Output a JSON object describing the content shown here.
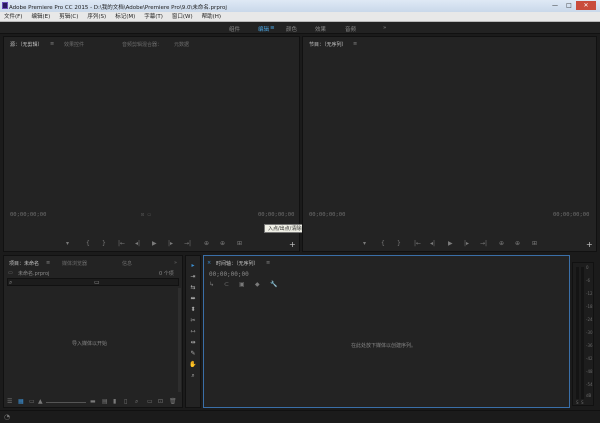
{
  "window": {
    "title": "Adobe Premiere Pro CC 2015 - D:\\我的文档\\Adobe\\Premiere Pro\\9.0\\未命名.prproj",
    "minimize": "—",
    "maximize": "□",
    "close": "✕"
  },
  "menu": [
    "文件(F)",
    "编辑(E)",
    "剪辑(C)",
    "序列(S)",
    "标记(M)",
    "字幕(T)",
    "窗口(W)",
    "帮助(H)"
  ],
  "workspaces": {
    "tabs": [
      "组件",
      "编辑",
      "颜色",
      "效果",
      "音频"
    ],
    "active": "编辑",
    "edit_menu_glyph": "≡",
    "more": "»"
  },
  "source_monitor": {
    "tabs": [
      "源：（无剪辑）",
      "效果控件",
      "音频剪辑混合器：",
      "元数据"
    ],
    "menu_glyph": "≡",
    "timecode_left": "00;00;00;00",
    "timecode_right": "00;00;00;00",
    "add_glyph": "+",
    "controls": [
      "▾",
      "{",
      "}",
      "|←",
      "◂|",
      "▶",
      "|▸",
      "→|",
      "⊕",
      "⊕",
      "⊞"
    ]
  },
  "tooltip": "入点/出点/清除的时间",
  "program_monitor": {
    "tab": "节目：（无序列）",
    "menu_glyph": "≡",
    "timecode_left": "00;00;00;00",
    "timecode_right": "00;00;00;00",
    "add_glyph": "+",
    "controls": [
      "▾",
      "{",
      "}",
      "|←",
      "◂|",
      "▶",
      "|▸",
      "→|",
      "⊕",
      "⊕",
      "⊞"
    ]
  },
  "project_panel": {
    "tabs": [
      "项目：未命名",
      "媒体浏览器",
      "信息"
    ],
    "tab_menu_glyph": "≡",
    "more": "»",
    "file": "未命名.prproj",
    "count": "0 个项",
    "search_glyph": "⌕",
    "folder_glyph": "▭",
    "empty_message": "导入媒体以开始",
    "bottom_icons": [
      "☰",
      "▦",
      "▭",
      "▲",
      "▬",
      "▤",
      "▮",
      "▯",
      "⌕",
      "▭",
      "⊡",
      "🗑"
    ]
  },
  "tools": [
    "▸",
    "⇥",
    "⇆",
    "⬌",
    "⬍",
    "✂",
    "⇿",
    "⇹",
    "✎",
    "✋",
    "⌕"
  ],
  "timeline": {
    "tab": "时间轴：（无序列）",
    "close_glyph": "×",
    "menu_glyph": "≡",
    "timecode": "00;00;00;00",
    "icons": [
      "↳",
      "⊂",
      "▣",
      "◆",
      "🔧"
    ],
    "empty_message": "在此处放下媒体以创建序列。"
  },
  "audio_meter": {
    "scale": [
      "0",
      "-6",
      "-12",
      "-18",
      "-24",
      "-30",
      "-36",
      "-42",
      "-48",
      "-54",
      "dB"
    ],
    "solo": [
      "S",
      "S"
    ]
  },
  "status": "◔"
}
